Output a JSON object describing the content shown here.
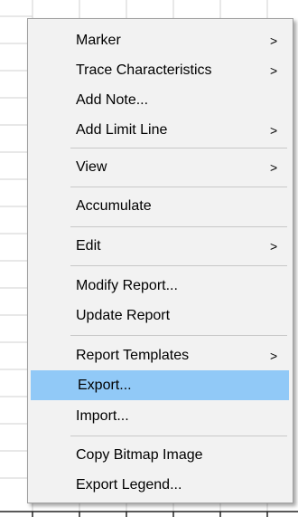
{
  "menu": {
    "items": [
      {
        "label": "Marker",
        "submenu": true
      },
      {
        "label": "Trace Characteristics",
        "submenu": true
      },
      {
        "label": "Add Note...",
        "submenu": false
      },
      {
        "label": "Add Limit Line",
        "submenu": true
      },
      {
        "label": "View",
        "submenu": true
      },
      {
        "label": "Accumulate",
        "submenu": false
      },
      {
        "label": "Edit",
        "submenu": true
      },
      {
        "label": "Modify Report...",
        "submenu": false
      },
      {
        "label": "Update Report",
        "submenu": false
      },
      {
        "label": "Report Templates",
        "submenu": true
      },
      {
        "label": "Export...",
        "submenu": false,
        "highlighted": true
      },
      {
        "label": "Import...",
        "submenu": false
      },
      {
        "label": "Copy Bitmap Image",
        "submenu": false
      },
      {
        "label": "Export Legend...",
        "submenu": false
      }
    ],
    "submenu_arrow": ">",
    "highlight_color": "#91c9f7"
  }
}
